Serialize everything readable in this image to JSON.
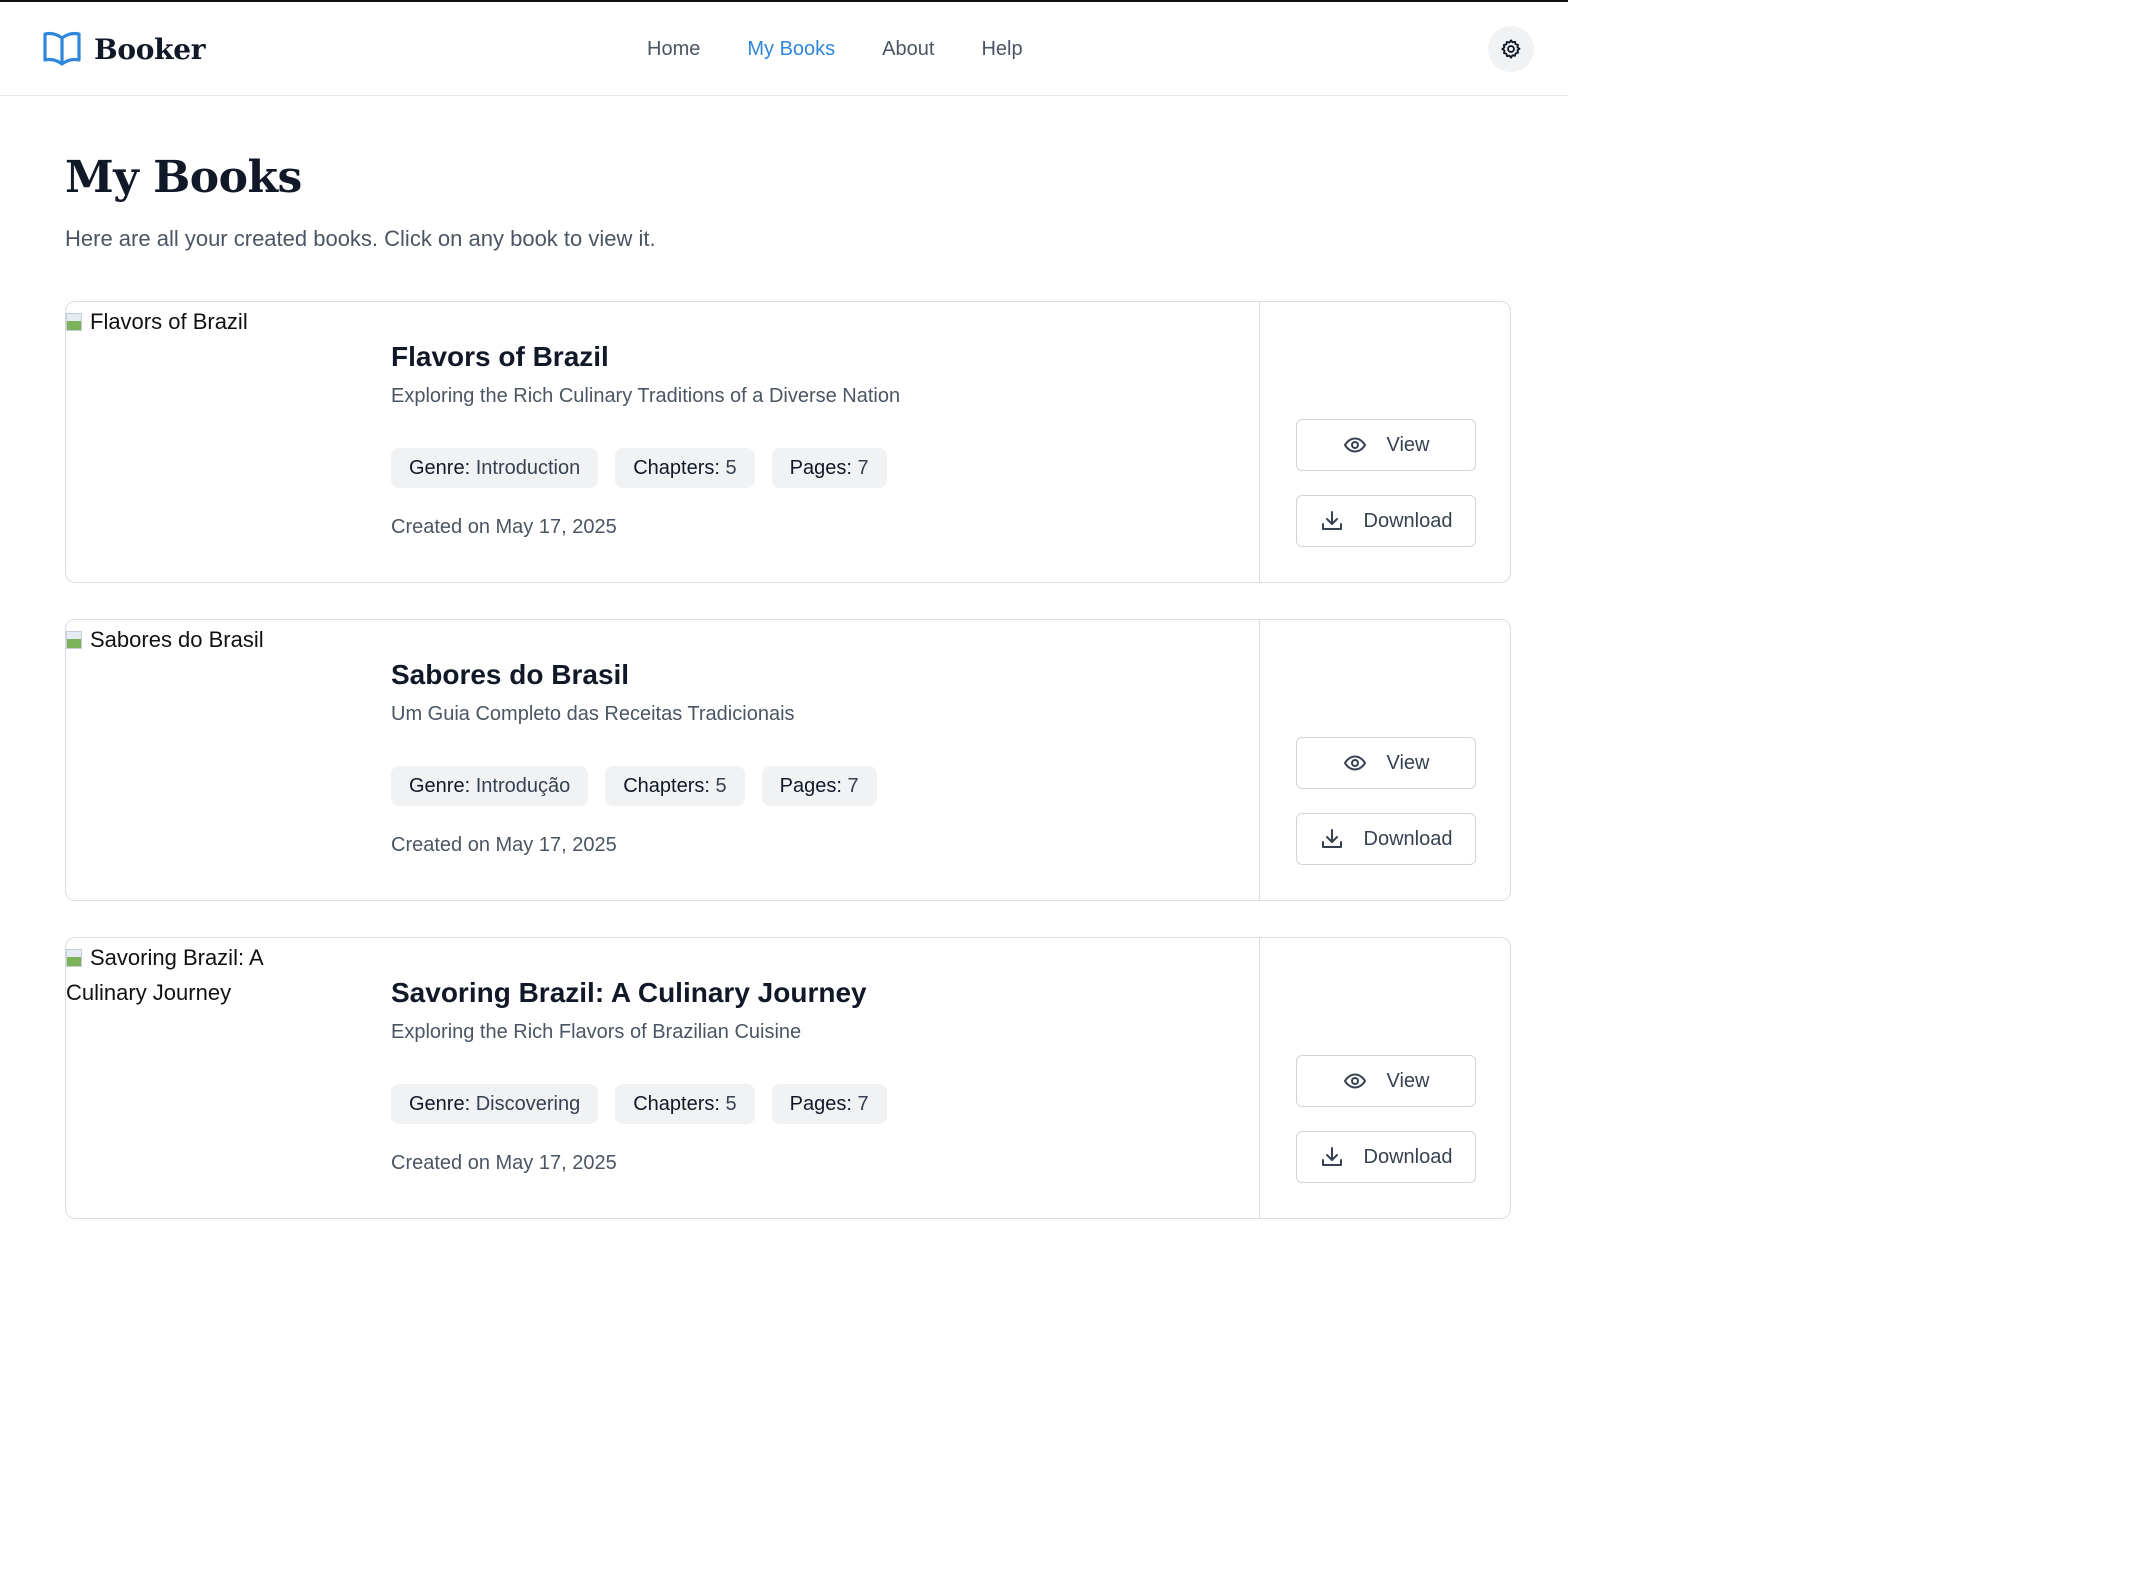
{
  "header": {
    "brand": "Booker",
    "nav": [
      {
        "label": "Home",
        "active": false
      },
      {
        "label": "My Books",
        "active": true
      },
      {
        "label": "About",
        "active": false
      },
      {
        "label": "Help",
        "active": false
      }
    ],
    "settings_icon": "gear-icon",
    "accent_color": "#2f86db"
  },
  "page": {
    "title": "My Books",
    "subtitle": "Here are all your created books. Click on any book to view it."
  },
  "books": [
    {
      "cover_alt": "Flavors of Brazil",
      "title": "Flavors of Brazil",
      "subtitle": "Exploring the Rich Culinary Traditions of a Diverse Nation",
      "genre_label": "Genre:",
      "genre": "Introduction",
      "chapters_label": "Chapters:",
      "chapters": "5",
      "pages_label": "Pages:",
      "pages": "7",
      "created": "Created on May 17, 2025",
      "view_label": "View",
      "download_label": "Download"
    },
    {
      "cover_alt": "Sabores do Brasil",
      "title": "Sabores do Brasil",
      "subtitle": "Um Guia Completo das Receitas Tradicionais",
      "genre_label": "Genre:",
      "genre": "Introdução",
      "chapters_label": "Chapters:",
      "chapters": "5",
      "pages_label": "Pages:",
      "pages": "7",
      "created": "Created on May 17, 2025",
      "view_label": "View",
      "download_label": "Download"
    },
    {
      "cover_alt": "Savoring Brazil: A Culinary Journey",
      "title": "Savoring Brazil: A Culinary Journey",
      "subtitle": "Exploring the Rich Flavors of Brazilian Cuisine",
      "genre_label": "Genre:",
      "genre": "Discovering",
      "chapters_label": "Chapters:",
      "chapters": "5",
      "pages_label": "Pages:",
      "pages": "7",
      "created": "Created on May 17, 2025",
      "view_label": "View",
      "download_label": "Download"
    }
  ]
}
